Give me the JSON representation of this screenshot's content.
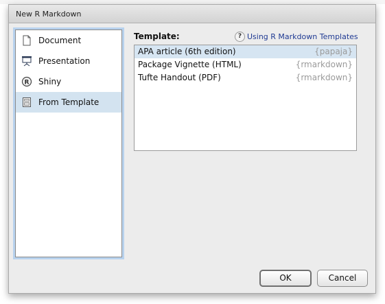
{
  "window": {
    "title": "New R Markdown"
  },
  "sidebar": {
    "items": [
      {
        "label": "Document",
        "icon": "document-icon",
        "selected": false
      },
      {
        "label": "Presentation",
        "icon": "presentation-icon",
        "selected": false
      },
      {
        "label": "Shiny",
        "icon": "shiny-icon",
        "selected": false
      },
      {
        "label": "From Template",
        "icon": "template-icon",
        "selected": true
      }
    ]
  },
  "main": {
    "template_label": "Template:",
    "help_link": "Using R Markdown Templates",
    "help_icon": "question-icon",
    "templates": [
      {
        "name": "APA article (6th edition)",
        "package": "{papaja}",
        "selected": true
      },
      {
        "name": "Package Vignette (HTML)",
        "package": "{rmarkdown}",
        "selected": false
      },
      {
        "name": "Tufte Handout (PDF)",
        "package": "{rmarkdown}",
        "selected": false
      }
    ]
  },
  "buttons": {
    "ok": "OK",
    "cancel": "Cancel"
  },
  "colors": {
    "selection": "#d6e5f2",
    "focus_ring": "#b8d2ee",
    "link": "#1f3a93",
    "package_text": "#9a9a9a"
  }
}
